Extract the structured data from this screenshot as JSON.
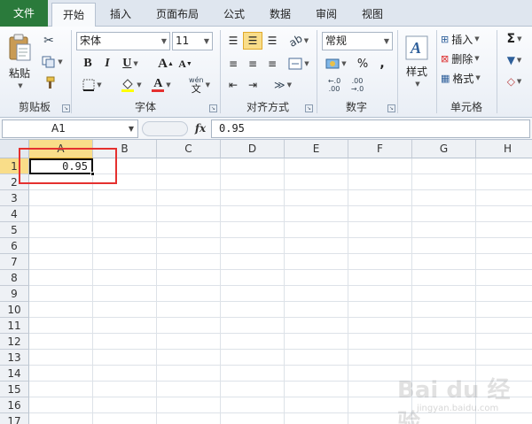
{
  "tabs": [
    "文件",
    "开始",
    "插入",
    "页面布局",
    "公式",
    "数据",
    "审阅",
    "视图"
  ],
  "active_tab": "开始",
  "clipboard": {
    "paste_label": "粘贴",
    "group_label": "剪贴板"
  },
  "font": {
    "name": "宋体",
    "size": "11",
    "bold": "B",
    "italic": "I",
    "underline": "U",
    "grow": "A",
    "shrink": "A",
    "phonetic": "wén",
    "group_label": "字体"
  },
  "alignment": {
    "group_label": "对齐方式"
  },
  "number": {
    "format": "常规",
    "percent": "%",
    "comma": ",",
    "inc_decimal": "←.0 .00",
    "dec_decimal": ".00 →.0",
    "group_label": "数字"
  },
  "styles": {
    "label": "样式"
  },
  "cells": {
    "insert": "插入",
    "delete": "删除",
    "format": "格式",
    "group_label": "单元格"
  },
  "editing": {
    "sum": "Σ"
  },
  "formula_bar": {
    "name_box": "A1",
    "fx": "fx",
    "content": "0.95"
  },
  "grid": {
    "columns": [
      "A",
      "B",
      "C",
      "D",
      "E",
      "F",
      "G",
      "H"
    ],
    "rows": [
      "1",
      "2",
      "3",
      "4",
      "5",
      "6",
      "7",
      "8",
      "9",
      "10",
      "11",
      "12",
      "13",
      "14",
      "15",
      "16",
      "17"
    ],
    "selected_column": "A",
    "selected_row": "1",
    "active_cell_value": "0.95"
  },
  "watermark": {
    "text": "Bai du 经验",
    "sub": "jingyan.baidu.com"
  },
  "colors": {
    "file_tab": "#2a7a3b",
    "selection": "#f9dd89",
    "highlight": "#e5302f"
  }
}
